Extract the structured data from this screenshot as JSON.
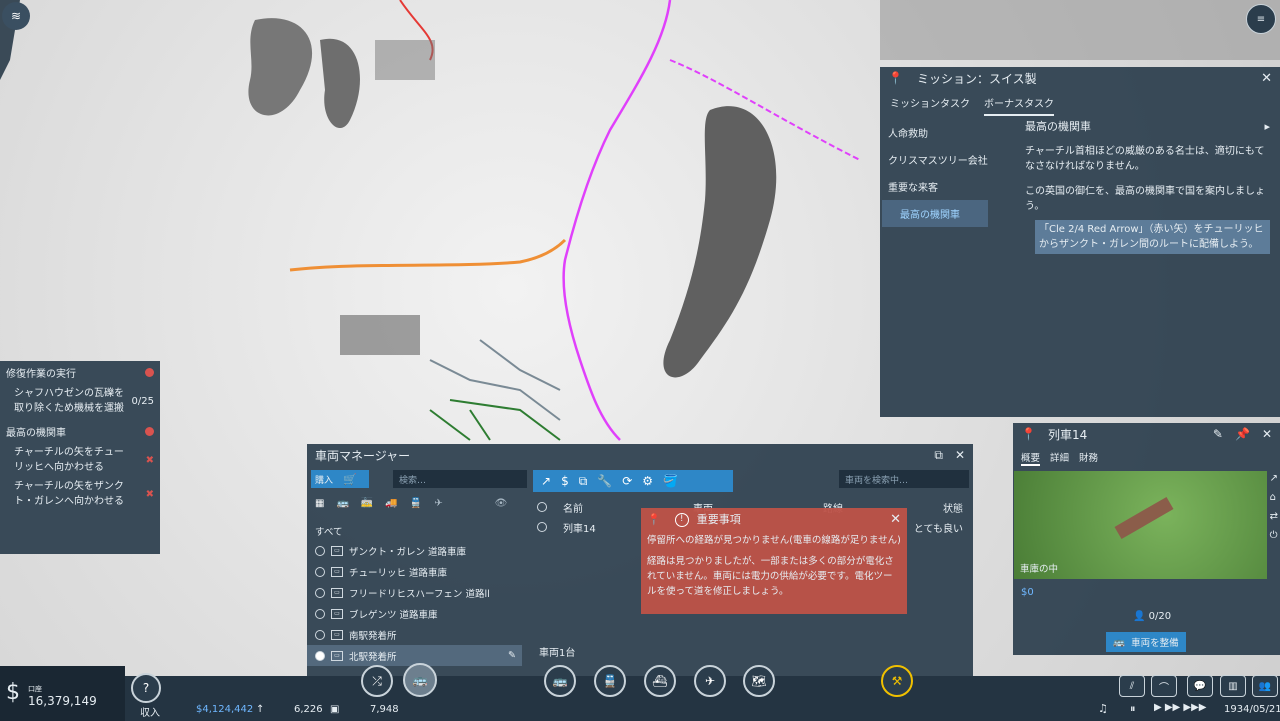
{
  "mission": {
    "title": "ミッション：スイス製",
    "tabs": [
      "ミッションタスク",
      "ボーナスタスク"
    ],
    "categories": [
      "人命救助",
      "クリスマスツリー会社",
      "重要な来客",
      "最高の機関車"
    ],
    "content_title": "最高の機関車",
    "para1": "チャーチル首相ほどの威厳のある名士は、適切にもてなさなければなりません。",
    "para2": "この英国の御仁を、最高の機関車で国を案内しましょう。",
    "highlight": "「Cle 2/4 Red Arrow」（赤い矢）をチューリッヒからザンクト・ガレン間のルートに配備しよう。"
  },
  "tasks": {
    "group1": "修復作業の実行",
    "task1": "シャフハウゼンの瓦礫を取り除くため機械を運搬",
    "task1_count": "0/25",
    "group2": "最高の機関車",
    "task2": "チャーチルの矢をチューリッヒへ向かわせる",
    "task3": "チャーチルの矢をザンクト・ガレンへ向かわせる"
  },
  "vehicle_manager": {
    "title": "車両マネージャー",
    "buy_label": "購入",
    "search_placeholder": "検索…",
    "vehicle_search_placeholder": "車両を検索中…",
    "filter_all": "すべて",
    "depots": [
      "ザンクト・ガレン 道路車庫",
      "チューリッヒ 道路車庫",
      "フリードリヒスハーフェン 道路ll",
      "ブレゲンツ 道路車庫",
      "南駅発着所",
      "北駅発着所"
    ],
    "columns": {
      "name": "名前",
      "vehicle": "車両",
      "route": "路線",
      "status": "状態"
    },
    "rows": [
      {
        "name": "列車14",
        "status": "とても良い"
      }
    ],
    "count": "車両1台"
  },
  "alert": {
    "title": "重要事項",
    "line1": "停留所への経路が見つかりません(電車の線路が足りません)",
    "line2": "経路は見つかりましたが、一部または多くの部分が電化されていません。車両には電力の供給が必要です。電化ツールを使って道を修正しましょう。"
  },
  "train": {
    "title": "列車14",
    "tabs": [
      "概要",
      "詳細",
      "財務"
    ],
    "caption": "車庫の中",
    "money": "$0",
    "passengers": "0/20",
    "service_button": "車両を整備"
  },
  "bottom": {
    "account_label": "口座",
    "balance": "16,379,149",
    "income_label": "収入",
    "income": "$4,124,442",
    "population": "6,226",
    "cargo": "7,948",
    "date": "1934/05/21"
  },
  "colors": {
    "accent": "#2e87c7",
    "alert": "#be5248",
    "panel": "#2c3e4e"
  }
}
